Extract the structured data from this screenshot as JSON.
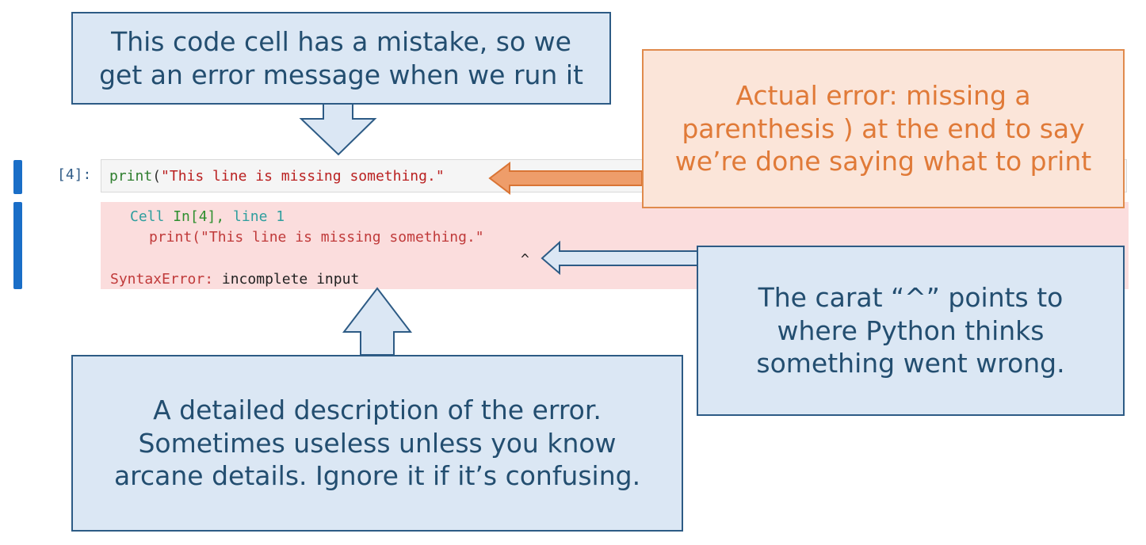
{
  "cell": {
    "prompt": "[4]:",
    "input": {
      "func": "print",
      "open_paren": "(",
      "string": "\"This line is missing something.\""
    },
    "output": {
      "location": {
        "prefix": "Cell ",
        "cell_ref": "In[4],",
        "suffix": " line 1"
      },
      "source_line": "print(\"This line is missing something.\"",
      "caret": "^",
      "error_type": "SyntaxError:",
      "error_message": " incomplete input"
    }
  },
  "callouts": {
    "top": {
      "line1": "This code cell has a mistake, so we",
      "line2": "get an error message when we run it"
    },
    "orange": {
      "line1": "Actual error: missing a",
      "line2": "parenthesis ) at the end to say",
      "line3": "we’re done saying what to print"
    },
    "carat": {
      "line1": "The carat “^” points to",
      "line2": "where Python thinks",
      "line3": "something went wrong."
    },
    "bottom": {
      "line1": "A detailed description of the error.",
      "line2": "Sometimes useless unless you know",
      "line3": "arcane details.  Ignore it if it’s confusing."
    }
  },
  "colors": {
    "callout_blue_fill": "#dbe7f4",
    "callout_blue_border": "#2d5b85",
    "callout_orange_fill": "#fbe5d9",
    "callout_orange_border": "#e08a4c",
    "error_background": "#fbdddd",
    "cell_bar": "#1a6ec7"
  }
}
